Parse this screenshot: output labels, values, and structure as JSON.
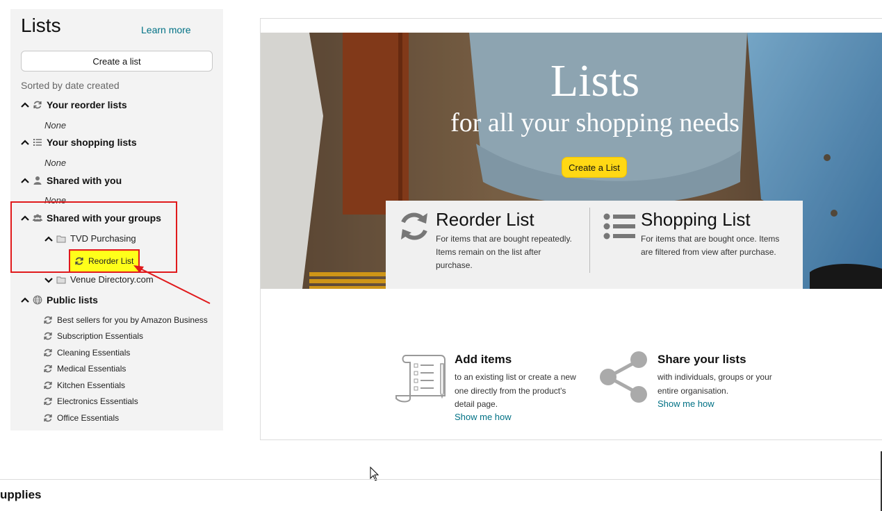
{
  "sidebar": {
    "title": "Lists",
    "learn_more": "Learn more",
    "create_button": "Create a list",
    "sorted_label": "Sorted by date created",
    "sections": {
      "reorder": {
        "label": "Your reorder lists",
        "empty": "None"
      },
      "shopping": {
        "label": "Your shopping lists",
        "empty": "None"
      },
      "shared_you": {
        "label": "Shared with you",
        "empty": "None"
      },
      "shared_groups": {
        "label": "Shared with your groups",
        "groups": [
          {
            "label": "TVD Purchasing",
            "lists": [
              "Reorder List"
            ]
          },
          {
            "label": "Venue Directory.com"
          }
        ]
      },
      "public": {
        "label": "Public lists",
        "items": [
          "Best sellers for you by Amazon Business",
          "Subscription Essentials",
          "Cleaning Essentials",
          "Medical Essentials",
          "Kitchen Essentials",
          "Electronics Essentials",
          "Office Essentials"
        ]
      }
    }
  },
  "hero": {
    "title": "Lists",
    "subtitle": "for all your shopping needs",
    "button": "Create a List",
    "reorder": {
      "title": "Reorder List",
      "desc_lines": [
        "For items that are bought repeatedly.",
        "Items remain on the list after",
        "purchase."
      ]
    },
    "shopping": {
      "title": "Shopping List",
      "desc_lines": [
        "For items that are bought once. Items",
        "are filtered from view after purchase."
      ]
    }
  },
  "features": {
    "add": {
      "title": "Add items",
      "desc_lines": [
        "to an existing list or create a new",
        "one directly from the product's",
        "detail page."
      ],
      "link": "Show me how"
    },
    "share": {
      "title": "Share your lists",
      "desc_lines": [
        "with individuals, groups or your",
        "entire organisation."
      ],
      "link": "Show me how"
    }
  },
  "footer": {
    "partial_text": "upplies"
  },
  "colors": {
    "link": "#007185",
    "button_yellow": "#ffd814",
    "annotation_red": "#e0191b",
    "highlight_yellow": "#ffff1a"
  }
}
